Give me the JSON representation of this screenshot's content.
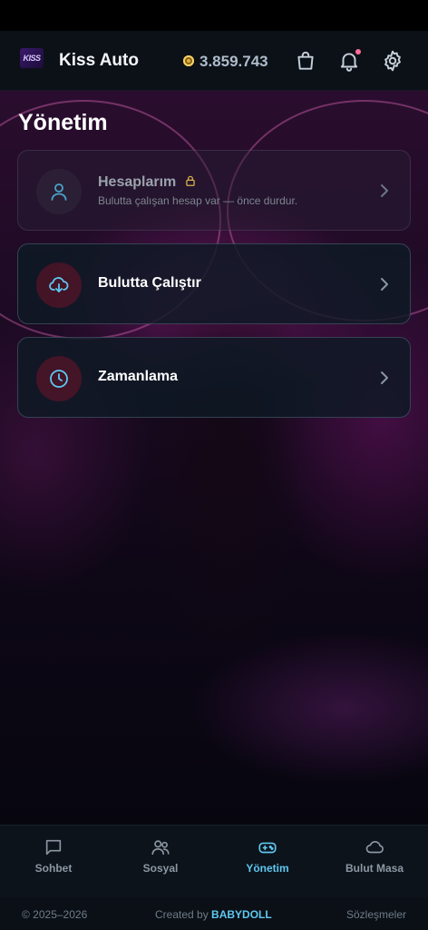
{
  "header": {
    "app_title": "Kiss Auto",
    "logo_text": "KISS",
    "coin_balance": "3.859.743",
    "icons": [
      "bag-icon",
      "bell-icon",
      "gear-icon"
    ]
  },
  "page_title": "Yönetim",
  "cards": [
    {
      "title": "Hesaplarım",
      "subtitle": "Bulutta çalışan hesap var — önce durdur.",
      "icon": "user-icon",
      "locked": true
    },
    {
      "title": "Bulutta Çalıştır",
      "icon": "cloud-download-icon",
      "locked": false
    },
    {
      "title": "Zamanlama",
      "icon": "clock-icon",
      "locked": false
    }
  ],
  "tabs": [
    {
      "label": "Sohbet",
      "icon": "chat-icon"
    },
    {
      "label": "Sosyal",
      "icon": "users-icon"
    },
    {
      "label": "Yönetim",
      "icon": "gamepad-icon",
      "active": true
    },
    {
      "label": "Bulut Masa",
      "icon": "cloud-icon"
    }
  ],
  "footer": {
    "copyright": "© 2025–2026",
    "created_prefix": "Created by ",
    "created_by": "BABYDOLL",
    "legal": "Sözleşmeler"
  },
  "colors": {
    "accent": "#5ec8f0",
    "header_bg": "#0c1118",
    "coin": "#e3b341",
    "notification_dot": "#ff6b9a"
  }
}
